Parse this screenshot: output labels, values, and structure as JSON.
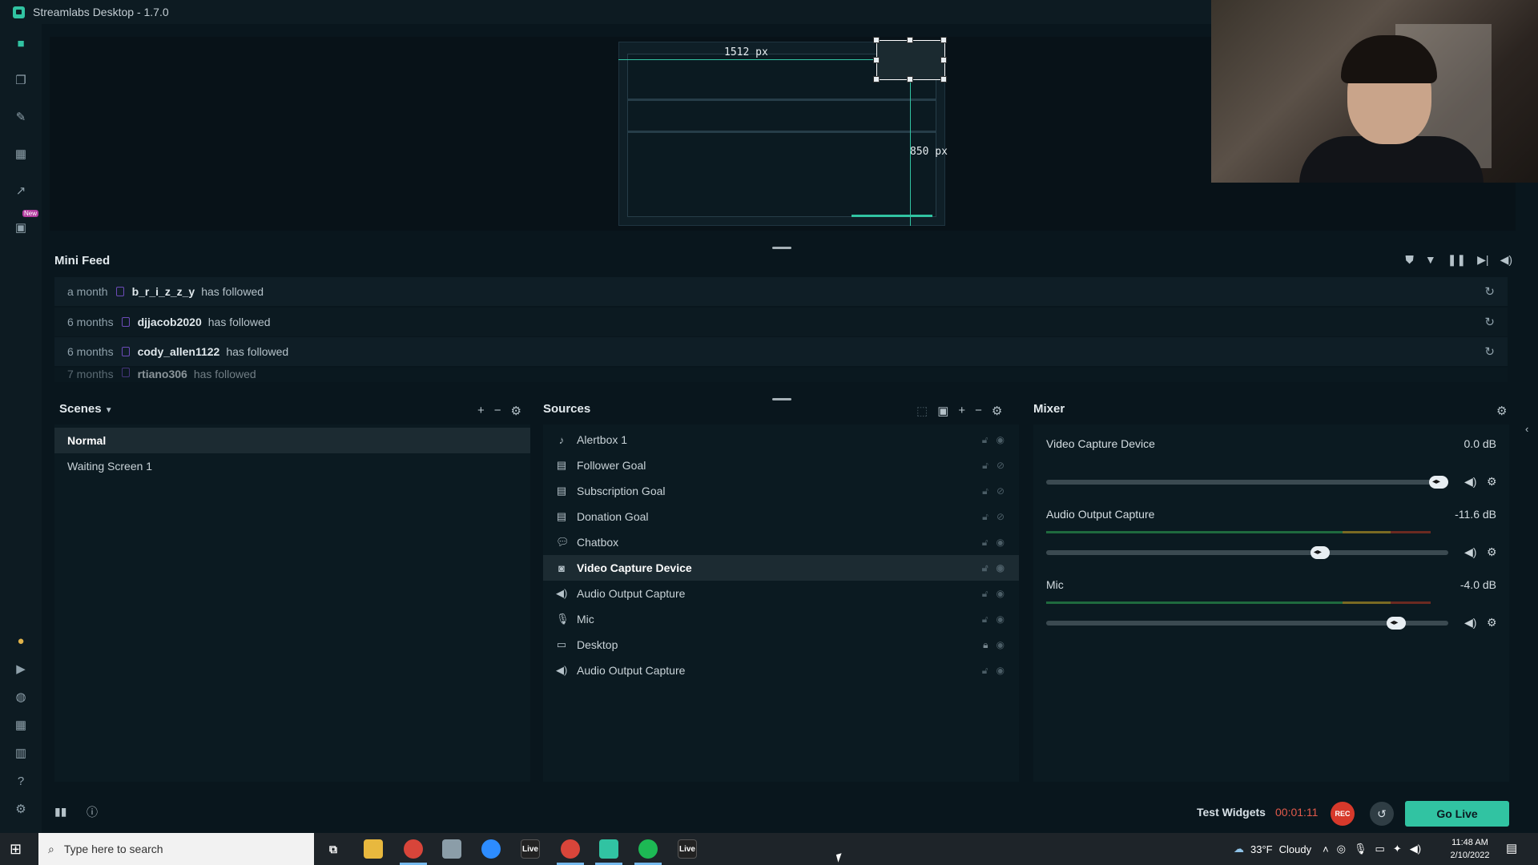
{
  "window": {
    "title": "Streamlabs Desktop - 1.7.0"
  },
  "editor": {
    "width_label": "1512 px",
    "height_label": "850 px"
  },
  "mini_feed": {
    "title": "Mini Feed",
    "items": [
      {
        "time": "a month",
        "user": "b_r_i_z_z_y",
        "action": "has followed"
      },
      {
        "time": "6 months",
        "user": "djjacob2020",
        "action": "has followed"
      },
      {
        "time": "6 months",
        "user": "cody_allen1122",
        "action": "has followed"
      },
      {
        "time": "7 months",
        "user": "rtiano306",
        "action": "has followed"
      }
    ]
  },
  "scenes": {
    "title": "Scenes",
    "items": [
      {
        "label": "Normal",
        "active": true
      },
      {
        "label": "Waiting Screen 1",
        "active": false
      }
    ]
  },
  "sources": {
    "title": "Sources",
    "items": [
      {
        "label": "Alertbox 1",
        "icon": "bell-icon"
      },
      {
        "label": "Follower Goal",
        "icon": "calendar-icon"
      },
      {
        "label": "Subscription Goal",
        "icon": "calendar-icon"
      },
      {
        "label": "Donation Goal",
        "icon": "calendar-icon"
      },
      {
        "label": "Chatbox",
        "icon": "chat-icon"
      },
      {
        "label": "Video Capture Device",
        "icon": "webcam-icon"
      },
      {
        "label": "Audio Output Capture",
        "icon": "speaker-icon"
      },
      {
        "label": "Mic",
        "icon": "mic-icon"
      },
      {
        "label": "Desktop",
        "icon": "monitor-icon"
      },
      {
        "label": "Audio Output Capture",
        "icon": "speaker-icon"
      }
    ]
  },
  "mixer": {
    "title": "Mixer",
    "channels": [
      {
        "name": "Video Capture Device",
        "db": "0.0 dB",
        "level": 1.0
      },
      {
        "name": "Audio Output Capture",
        "db": "-11.6 dB",
        "level": 0.69
      },
      {
        "name": "Mic",
        "db": "-4.0 dB",
        "level": 0.89
      }
    ]
  },
  "footer": {
    "test_widgets": "Test Widgets",
    "timer": "00:01:11",
    "rec": "REC",
    "go_live": "Go Live"
  },
  "taskbar": {
    "search_placeholder": "Type here to search",
    "temperature": "33°F",
    "weather": "Cloudy",
    "time": "11:48 AM",
    "date": "2/10/2022"
  },
  "colors": {
    "accent": "#31c3a2",
    "rec": "#d7392b",
    "timer": "#e25a4b"
  }
}
